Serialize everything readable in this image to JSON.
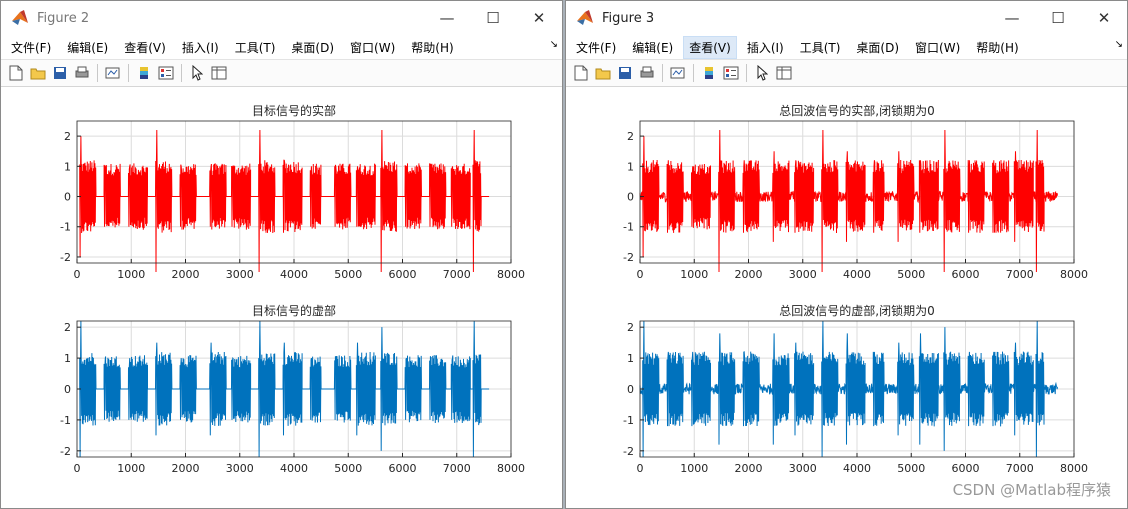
{
  "windows": [
    {
      "title": "Figure 2",
      "active": false,
      "menu": [
        "文件(F)",
        "编辑(E)",
        "查看(V)",
        "插入(I)",
        "工具(T)",
        "桌面(D)",
        "窗口(W)",
        "帮助(H)"
      ],
      "active_menu": -1
    },
    {
      "title": "Figure 3",
      "active": true,
      "menu": [
        "文件(F)",
        "编辑(E)",
        "查看(V)",
        "插入(I)",
        "工具(T)",
        "桌面(D)",
        "窗口(W)",
        "帮助(H)"
      ],
      "active_menu": 2
    }
  ],
  "window_controls": [
    "minimize-icon",
    "maximize-icon",
    "close-icon"
  ],
  "toolbar_icons": [
    "new-figure-icon",
    "open-file-icon",
    "save-icon",
    "print-icon",
    "separator",
    "link-plot-icon",
    "separator",
    "insert-colorbar-icon",
    "insert-legend-icon",
    "separator",
    "edit-plot-arrow-icon",
    "property-inspector-icon"
  ],
  "colors": {
    "real": "#ff0000",
    "imag": "#0072bd",
    "grid": "#dcdcdc",
    "axis": "#262626"
  },
  "watermark": "CSDN @Matlab程序猿",
  "chart_data": [
    {
      "type": "line",
      "window": "Figure 2",
      "title": "目标信号的实部",
      "color": "#ff0000",
      "xlim": [
        0,
        8000
      ],
      "ylim": [
        -2.2,
        2.5
      ],
      "xticks": [
        0,
        1000,
        2000,
        3000,
        4000,
        5000,
        6000,
        7000,
        8000
      ],
      "yticks": [
        -2,
        -1,
        0,
        1,
        2
      ],
      "grid": true,
      "noise_between_pulses": false,
      "end_x": 7600,
      "pulses": [
        [
          50,
          350,
          2.0
        ],
        [
          500,
          800,
          1.0
        ],
        [
          950,
          1300,
          1.0
        ],
        [
          1450,
          1750,
          2.5
        ],
        [
          1900,
          2200,
          1.0
        ],
        [
          2450,
          2750,
          1.0
        ],
        [
          2850,
          3200,
          1.0
        ],
        [
          3350,
          3650,
          2.5
        ],
        [
          3800,
          4150,
          1.2
        ],
        [
          4300,
          4500,
          1.0
        ],
        [
          4750,
          5050,
          1.0
        ],
        [
          5150,
          5500,
          1.0
        ],
        [
          5600,
          5900,
          2.5
        ],
        [
          6050,
          6350,
          1.0
        ],
        [
          6500,
          6800,
          1.0
        ],
        [
          6900,
          7250,
          1.0
        ],
        [
          7300,
          7450,
          2.5
        ]
      ]
    },
    {
      "type": "line",
      "window": "Figure 2",
      "title": "目标信号的虚部",
      "color": "#0072bd",
      "xlim": [
        0,
        8000
      ],
      "ylim": [
        -2.2,
        2.2
      ],
      "xticks": [
        0,
        1000,
        2000,
        3000,
        4000,
        5000,
        6000,
        7000,
        8000
      ],
      "yticks": [
        -2,
        -1,
        0,
        1,
        2
      ],
      "grid": true,
      "noise_between_pulses": false,
      "end_x": 7600,
      "pulses": [
        [
          50,
          350,
          2.2
        ],
        [
          500,
          800,
          1.0
        ],
        [
          950,
          1300,
          1.0
        ],
        [
          1450,
          1750,
          1.5
        ],
        [
          1900,
          2200,
          1.0
        ],
        [
          2450,
          2750,
          1.5
        ],
        [
          2850,
          3200,
          1.0
        ],
        [
          3350,
          3650,
          2.2
        ],
        [
          3800,
          4150,
          1.5
        ],
        [
          4300,
          4500,
          1.0
        ],
        [
          4750,
          5050,
          1.0
        ],
        [
          5150,
          5500,
          1.5
        ],
        [
          5600,
          5900,
          2.0
        ],
        [
          6050,
          6350,
          1.0
        ],
        [
          6500,
          6800,
          1.0
        ],
        [
          6900,
          7250,
          1.0
        ],
        [
          7300,
          7450,
          2.2
        ]
      ]
    },
    {
      "type": "line",
      "window": "Figure 3",
      "title": "总回波信号的实部,闭锁期为0",
      "color": "#ff0000",
      "xlim": [
        0,
        8000
      ],
      "ylim": [
        -2.2,
        2.5
      ],
      "xticks": [
        0,
        1000,
        2000,
        3000,
        4000,
        5000,
        6000,
        7000,
        8000
      ],
      "yticks": [
        -2,
        -1,
        0,
        1,
        2
      ],
      "grid": true,
      "noise_between_pulses": true,
      "end_x": 7700,
      "pulses": [
        [
          50,
          350,
          2.0
        ],
        [
          500,
          800,
          1.2
        ],
        [
          950,
          1300,
          1.0
        ],
        [
          1450,
          1750,
          2.5
        ],
        [
          1900,
          2200,
          1.2
        ],
        [
          2450,
          2750,
          1.5
        ],
        [
          2850,
          3200,
          1.2
        ],
        [
          3350,
          3650,
          2.5
        ],
        [
          3800,
          4150,
          1.5
        ],
        [
          4300,
          4500,
          1.2
        ],
        [
          4750,
          5050,
          1.5
        ],
        [
          5150,
          5500,
          1.2
        ],
        [
          5600,
          5900,
          2.5
        ],
        [
          6050,
          6350,
          1.2
        ],
        [
          6500,
          6800,
          1.2
        ],
        [
          6900,
          7250,
          1.5
        ],
        [
          7300,
          7450,
          2.5
        ]
      ]
    },
    {
      "type": "line",
      "window": "Figure 3",
      "title": "总回波信号的虚部,闭锁期为0",
      "color": "#0072bd",
      "xlim": [
        0,
        8000
      ],
      "ylim": [
        -2.2,
        2.2
      ],
      "xticks": [
        0,
        1000,
        2000,
        3000,
        4000,
        5000,
        6000,
        7000,
        8000
      ],
      "yticks": [
        -2,
        -1,
        0,
        1,
        2
      ],
      "grid": true,
      "noise_between_pulses": true,
      "end_x": 7700,
      "pulses": [
        [
          50,
          350,
          2.2
        ],
        [
          500,
          800,
          1.2
        ],
        [
          950,
          1300,
          1.2
        ],
        [
          1450,
          1750,
          1.8
        ],
        [
          1900,
          2200,
          1.2
        ],
        [
          2450,
          2750,
          1.8
        ],
        [
          2850,
          3200,
          1.5
        ],
        [
          3350,
          3650,
          2.2
        ],
        [
          3800,
          4150,
          1.8
        ],
        [
          4300,
          4500,
          1.2
        ],
        [
          4750,
          5050,
          1.5
        ],
        [
          5150,
          5500,
          1.8
        ],
        [
          5600,
          5900,
          2.0
        ],
        [
          6050,
          6350,
          1.2
        ],
        [
          6500,
          6800,
          1.2
        ],
        [
          6900,
          7250,
          1.5
        ],
        [
          7300,
          7450,
          2.2
        ]
      ]
    }
  ]
}
